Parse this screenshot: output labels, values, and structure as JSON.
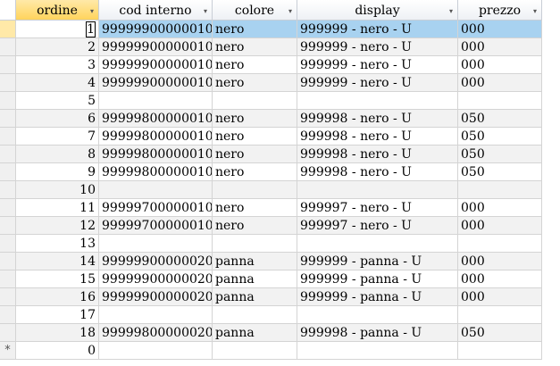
{
  "columns": [
    {
      "label": "ordine",
      "dropdown": "▾"
    },
    {
      "label": "cod interno",
      "dropdown": "▾"
    },
    {
      "label": "colore",
      "dropdown": "▾"
    },
    {
      "label": "display",
      "dropdown": "▾"
    },
    {
      "label": "prezzo",
      "dropdown": "▾"
    }
  ],
  "rows": [
    {
      "ordine": "1",
      "cod": "99999900000010",
      "colore": "nero",
      "display": "999999 - nero - U",
      "prezzo": "000"
    },
    {
      "ordine": "2",
      "cod": "99999900000010",
      "colore": "nero",
      "display": "999999 - nero - U",
      "prezzo": "000"
    },
    {
      "ordine": "3",
      "cod": "99999900000010",
      "colore": "nero",
      "display": "999999 - nero - U",
      "prezzo": "000"
    },
    {
      "ordine": "4",
      "cod": "99999900000010",
      "colore": "nero",
      "display": "999999 - nero - U",
      "prezzo": "000"
    },
    {
      "ordine": "5",
      "cod": "",
      "colore": "",
      "display": "",
      "prezzo": ""
    },
    {
      "ordine": "6",
      "cod": "99999800000010",
      "colore": "nero",
      "display": "999998 - nero - U",
      "prezzo": "050"
    },
    {
      "ordine": "7",
      "cod": "99999800000010",
      "colore": "nero",
      "display": "999998 - nero - U",
      "prezzo": "050"
    },
    {
      "ordine": "8",
      "cod": "99999800000010",
      "colore": "nero",
      "display": "999998 - nero - U",
      "prezzo": "050"
    },
    {
      "ordine": "9",
      "cod": "99999800000010",
      "colore": "nero",
      "display": "999998 - nero - U",
      "prezzo": "050"
    },
    {
      "ordine": "10",
      "cod": "",
      "colore": "",
      "display": "",
      "prezzo": ""
    },
    {
      "ordine": "11",
      "cod": "99999700000010",
      "colore": "nero",
      "display": "999997 - nero - U",
      "prezzo": "000"
    },
    {
      "ordine": "12",
      "cod": "99999700000010",
      "colore": "nero",
      "display": "999997 - nero - U",
      "prezzo": "000"
    },
    {
      "ordine": "13",
      "cod": "",
      "colore": "",
      "display": "",
      "prezzo": ""
    },
    {
      "ordine": "14",
      "cod": "99999900000020",
      "colore": "panna",
      "display": "999999 - panna - U",
      "prezzo": "000"
    },
    {
      "ordine": "15",
      "cod": "99999900000020",
      "colore": "panna",
      "display": "999999 - panna - U",
      "prezzo": "000"
    },
    {
      "ordine": "16",
      "cod": "99999900000020",
      "colore": "panna",
      "display": "999999 - panna - U",
      "prezzo": "000"
    },
    {
      "ordine": "17",
      "cod": "",
      "colore": "",
      "display": "",
      "prezzo": ""
    },
    {
      "ordine": "18",
      "cod": "99999800000020",
      "colore": "panna",
      "display": "999998 - panna - U",
      "prezzo": "050"
    }
  ],
  "new_row": {
    "marker": "*",
    "ordine": "0"
  },
  "current_row_index": 0,
  "colors": {
    "selection": "#a8d2f0",
    "header_selected": "#ffd45c",
    "grid_line": "#d4d4d4"
  }
}
